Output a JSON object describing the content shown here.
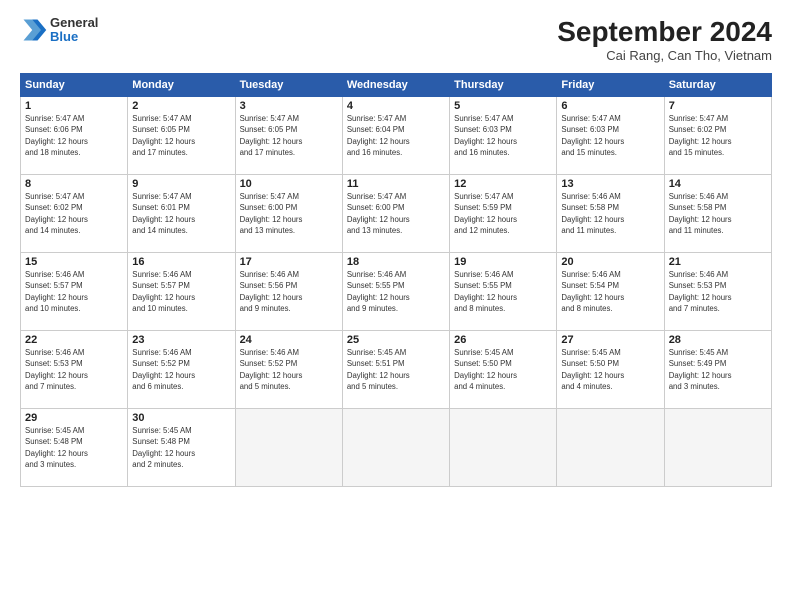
{
  "header": {
    "logo_general": "General",
    "logo_blue": "Blue",
    "month_title": "September 2024",
    "location": "Cai Rang, Can Tho, Vietnam"
  },
  "weekdays": [
    "Sunday",
    "Monday",
    "Tuesday",
    "Wednesday",
    "Thursday",
    "Friday",
    "Saturday"
  ],
  "weeks": [
    [
      {
        "num": "1",
        "info": "Sunrise: 5:47 AM\nSunset: 6:06 PM\nDaylight: 12 hours\nand 18 minutes."
      },
      {
        "num": "2",
        "info": "Sunrise: 5:47 AM\nSunset: 6:05 PM\nDaylight: 12 hours\nand 17 minutes."
      },
      {
        "num": "3",
        "info": "Sunrise: 5:47 AM\nSunset: 6:05 PM\nDaylight: 12 hours\nand 17 minutes."
      },
      {
        "num": "4",
        "info": "Sunrise: 5:47 AM\nSunset: 6:04 PM\nDaylight: 12 hours\nand 16 minutes."
      },
      {
        "num": "5",
        "info": "Sunrise: 5:47 AM\nSunset: 6:03 PM\nDaylight: 12 hours\nand 16 minutes."
      },
      {
        "num": "6",
        "info": "Sunrise: 5:47 AM\nSunset: 6:03 PM\nDaylight: 12 hours\nand 15 minutes."
      },
      {
        "num": "7",
        "info": "Sunrise: 5:47 AM\nSunset: 6:02 PM\nDaylight: 12 hours\nand 15 minutes."
      }
    ],
    [
      {
        "num": "8",
        "info": "Sunrise: 5:47 AM\nSunset: 6:02 PM\nDaylight: 12 hours\nand 14 minutes."
      },
      {
        "num": "9",
        "info": "Sunrise: 5:47 AM\nSunset: 6:01 PM\nDaylight: 12 hours\nand 14 minutes."
      },
      {
        "num": "10",
        "info": "Sunrise: 5:47 AM\nSunset: 6:00 PM\nDaylight: 12 hours\nand 13 minutes."
      },
      {
        "num": "11",
        "info": "Sunrise: 5:47 AM\nSunset: 6:00 PM\nDaylight: 12 hours\nand 13 minutes."
      },
      {
        "num": "12",
        "info": "Sunrise: 5:47 AM\nSunset: 5:59 PM\nDaylight: 12 hours\nand 12 minutes."
      },
      {
        "num": "13",
        "info": "Sunrise: 5:46 AM\nSunset: 5:58 PM\nDaylight: 12 hours\nand 11 minutes."
      },
      {
        "num": "14",
        "info": "Sunrise: 5:46 AM\nSunset: 5:58 PM\nDaylight: 12 hours\nand 11 minutes."
      }
    ],
    [
      {
        "num": "15",
        "info": "Sunrise: 5:46 AM\nSunset: 5:57 PM\nDaylight: 12 hours\nand 10 minutes."
      },
      {
        "num": "16",
        "info": "Sunrise: 5:46 AM\nSunset: 5:57 PM\nDaylight: 12 hours\nand 10 minutes."
      },
      {
        "num": "17",
        "info": "Sunrise: 5:46 AM\nSunset: 5:56 PM\nDaylight: 12 hours\nand 9 minutes."
      },
      {
        "num": "18",
        "info": "Sunrise: 5:46 AM\nSunset: 5:55 PM\nDaylight: 12 hours\nand 9 minutes."
      },
      {
        "num": "19",
        "info": "Sunrise: 5:46 AM\nSunset: 5:55 PM\nDaylight: 12 hours\nand 8 minutes."
      },
      {
        "num": "20",
        "info": "Sunrise: 5:46 AM\nSunset: 5:54 PM\nDaylight: 12 hours\nand 8 minutes."
      },
      {
        "num": "21",
        "info": "Sunrise: 5:46 AM\nSunset: 5:53 PM\nDaylight: 12 hours\nand 7 minutes."
      }
    ],
    [
      {
        "num": "22",
        "info": "Sunrise: 5:46 AM\nSunset: 5:53 PM\nDaylight: 12 hours\nand 7 minutes."
      },
      {
        "num": "23",
        "info": "Sunrise: 5:46 AM\nSunset: 5:52 PM\nDaylight: 12 hours\nand 6 minutes."
      },
      {
        "num": "24",
        "info": "Sunrise: 5:46 AM\nSunset: 5:52 PM\nDaylight: 12 hours\nand 5 minutes."
      },
      {
        "num": "25",
        "info": "Sunrise: 5:45 AM\nSunset: 5:51 PM\nDaylight: 12 hours\nand 5 minutes."
      },
      {
        "num": "26",
        "info": "Sunrise: 5:45 AM\nSunset: 5:50 PM\nDaylight: 12 hours\nand 4 minutes."
      },
      {
        "num": "27",
        "info": "Sunrise: 5:45 AM\nSunset: 5:50 PM\nDaylight: 12 hours\nand 4 minutes."
      },
      {
        "num": "28",
        "info": "Sunrise: 5:45 AM\nSunset: 5:49 PM\nDaylight: 12 hours\nand 3 minutes."
      }
    ],
    [
      {
        "num": "29",
        "info": "Sunrise: 5:45 AM\nSunset: 5:48 PM\nDaylight: 12 hours\nand 3 minutes."
      },
      {
        "num": "30",
        "info": "Sunrise: 5:45 AM\nSunset: 5:48 PM\nDaylight: 12 hours\nand 2 minutes."
      },
      {
        "num": "",
        "info": ""
      },
      {
        "num": "",
        "info": ""
      },
      {
        "num": "",
        "info": ""
      },
      {
        "num": "",
        "info": ""
      },
      {
        "num": "",
        "info": ""
      }
    ]
  ]
}
